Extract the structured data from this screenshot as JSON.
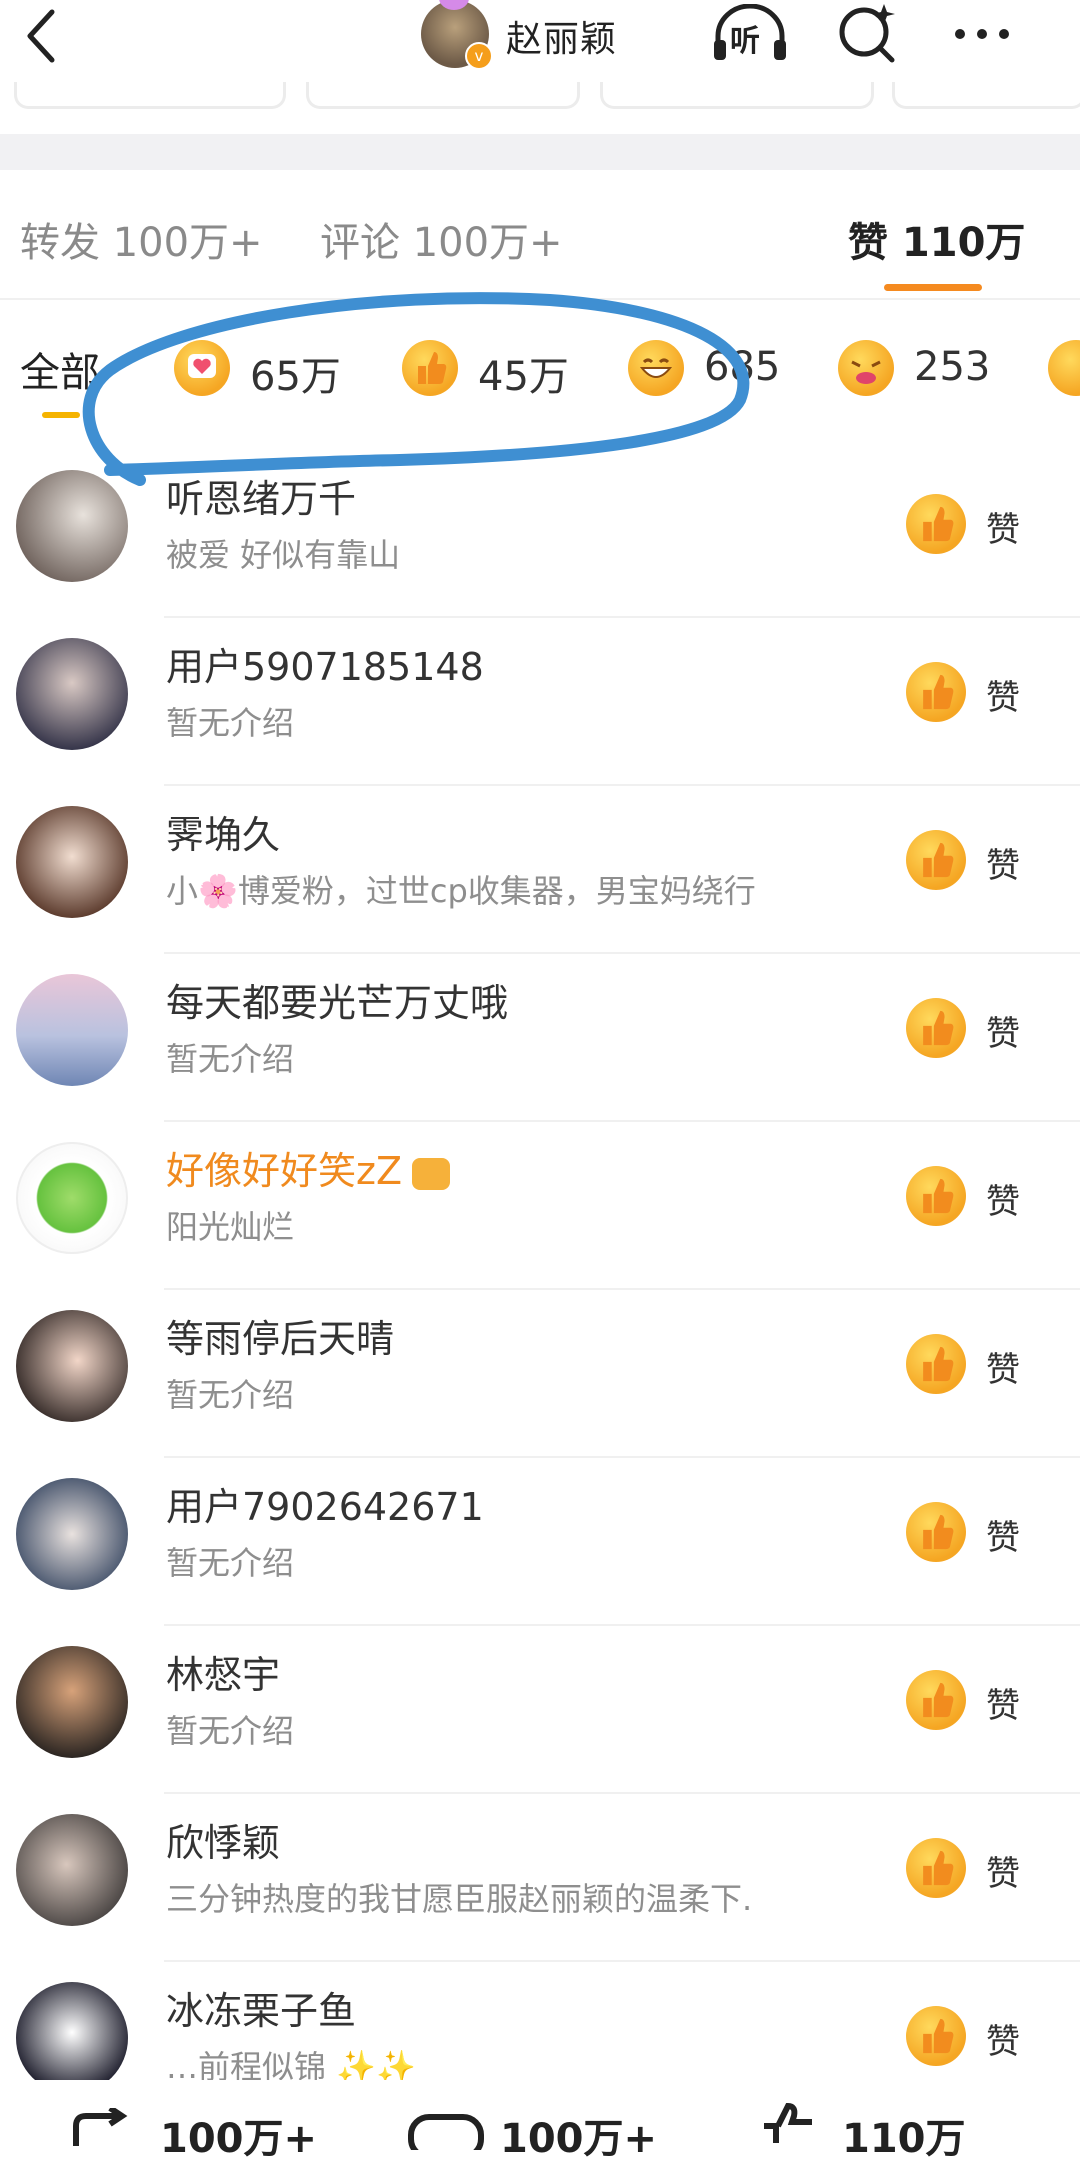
{
  "header": {
    "title": "赵丽颖",
    "listen_label": "听"
  },
  "tabs": [
    {
      "label": "转发 100万+"
    },
    {
      "label": "评论 100万+"
    },
    {
      "label": "赞 110万"
    }
  ],
  "filters": {
    "all_label": "全部",
    "items": [
      {
        "icon": "heart-face-icon",
        "count": "65万"
      },
      {
        "icon": "thumbs-up-icon",
        "count": "45万"
      },
      {
        "icon": "laugh-icon",
        "count": "685"
      },
      {
        "icon": "cry-icon",
        "count": "253"
      }
    ]
  },
  "users": [
    {
      "name": "听恩绪万千",
      "bio": "被爱  好似有靠山"
    },
    {
      "name": "用户5907185148",
      "bio": "暂无介绍"
    },
    {
      "name": "霁埆久",
      "bio": "小🌸博爱粉，过世cp收集器，男宝妈绕行"
    },
    {
      "name": "每天都要光芒万丈哦",
      "bio": "暂无介绍"
    },
    {
      "name": "好像好好笑zZ",
      "bio": "阳光灿烂"
    },
    {
      "name": "等雨停后天晴",
      "bio": "暂无介绍"
    },
    {
      "name": "用户7902642671",
      "bio": "暂无介绍"
    },
    {
      "name": "林惄宇",
      "bio": "暂无介绍"
    },
    {
      "name": "欣悸颖",
      "bio": "三分钟热度的我甘愿臣服赵丽颖的温柔下."
    },
    {
      "name": "冰冻栗子鱼",
      "bio": "…前程似锦 ✨✨"
    }
  ],
  "like_label": "赞",
  "bottom_bar": {
    "repost": "100万+",
    "comment": "100万+",
    "like": "110万"
  },
  "colors": {
    "accent": "#f58a1f",
    "annotation": "#3f8fd2",
    "vip_name": "#f08a1e"
  }
}
